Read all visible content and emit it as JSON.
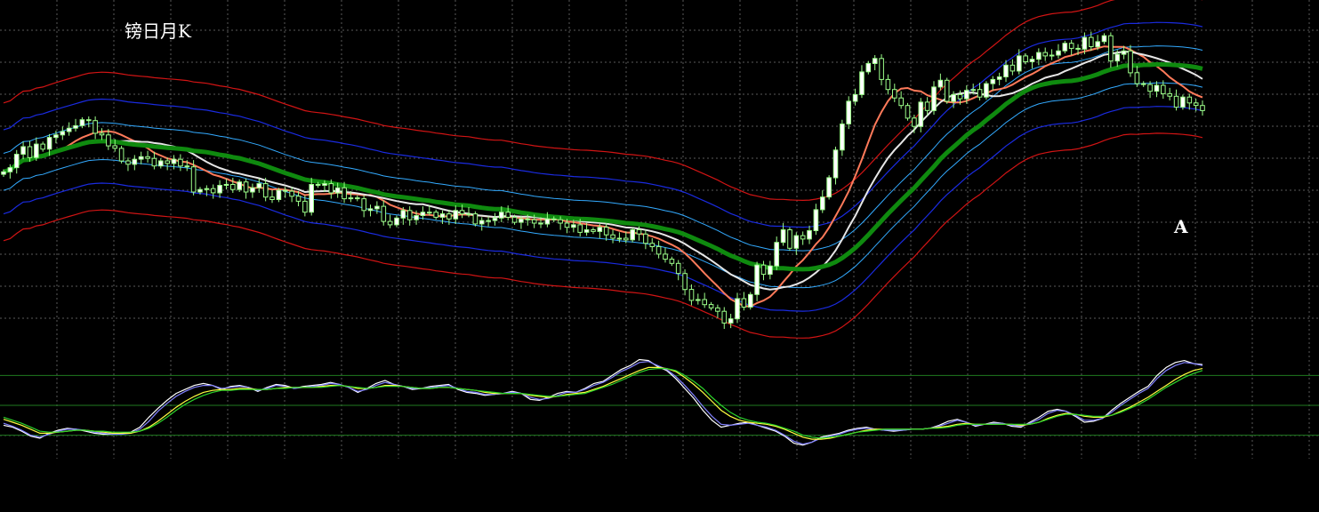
{
  "chart_data": {
    "type": "candlestick",
    "title": "镑日月K",
    "annotation": "A",
    "colors": {
      "background": "#000000",
      "grid": "#5a5a5a",
      "candle_up": "#ffffff",
      "candle_down": "#000000",
      "candle_outline": "#9dff8a",
      "ma_long": "#0f8a0f",
      "ma_mid": "#e6e6e6",
      "ma_fast": "#ff7a5a",
      "band_inner": "#33aaff",
      "band_mid": "#1a2be0",
      "band_outer": "#d11414",
      "osc_level": "#1f7a1f"
    },
    "price_closes": [
      206,
      211,
      227,
      236,
      223,
      239,
      233,
      247,
      250,
      254,
      258,
      261,
      268,
      267,
      252,
      250,
      237,
      234,
      219,
      215,
      221,
      224,
      222,
      213,
      219,
      216,
      221,
      213,
      212,
      182,
      185,
      186,
      181,
      190,
      191,
      185,
      194,
      182,
      187,
      192,
      176,
      173,
      184,
      183,
      177,
      171,
      158,
      191,
      190,
      192,
      181,
      187,
      174,
      175,
      174,
      160,
      162,
      165,
      147,
      143,
      151,
      160,
      149,
      154,
      158,
      158,
      152,
      156,
      150,
      160,
      156,
      156,
      144,
      148,
      148,
      151,
      158,
      152,
      146,
      150,
      149,
      145,
      144,
      150,
      149,
      145,
      140,
      143,
      134,
      137,
      135,
      140,
      131,
      127,
      127,
      125,
      137,
      132,
      121,
      117,
      108,
      102,
      97,
      85,
      66,
      53,
      54,
      48,
      44,
      40,
      26,
      31,
      55,
      45,
      60,
      95,
      84,
      94,
      122,
      137,
      115,
      130,
      126,
      136,
      161,
      176,
      199,
      232,
      263,
      290,
      298,
      325,
      335,
      341,
      316,
      304,
      294,
      285,
      270,
      260,
      289,
      279,
      307,
      315,
      290,
      298,
      293,
      303,
      304,
      295,
      311,
      316,
      319,
      333,
      326,
      344,
      337,
      340,
      348,
      344,
      345,
      350,
      359,
      353,
      352,
      366,
      355,
      361,
      368,
      338,
      346,
      350,
      324,
      311,
      310,
      302,
      309,
      299,
      296,
      283,
      295,
      288,
      285,
      279
    ],
    "oscillator": {
      "levels": [
        80,
        50,
        20
      ],
      "series": [
        {
          "color": "#ffffff",
          "values": [
            30,
            28,
            24,
            19,
            17,
            22,
            25,
            27,
            26,
            24,
            22,
            21,
            21,
            22,
            23,
            28,
            38,
            47,
            55,
            62,
            66,
            70,
            72,
            70,
            66,
            69,
            70,
            68,
            64,
            68,
            71,
            70,
            67,
            69,
            70,
            71,
            73,
            71,
            68,
            63,
            67,
            72,
            75,
            71,
            69,
            66,
            67,
            69,
            70,
            71,
            66,
            63,
            62,
            60,
            61,
            62,
            64,
            62,
            56,
            55,
            58,
            62,
            64,
            63,
            67,
            72,
            74,
            80,
            86,
            90,
            96,
            95,
            89,
            85,
            77,
            67,
            57,
            45,
            35,
            28,
            30,
            32,
            33,
            30,
            27,
            24,
            19,
            12,
            10,
            13,
            18,
            20,
            22,
            25,
            27,
            28,
            26,
            25,
            24,
            25,
            26,
            26,
            27,
            30,
            34,
            36,
            33,
            29,
            31,
            33,
            32,
            29,
            28,
            33,
            38,
            44,
            46,
            44,
            39,
            33,
            34,
            37,
            45,
            52,
            58,
            64,
            69,
            80,
            88,
            93,
            95,
            92,
            91
          ]
        },
        {
          "color": "#8080ff",
          "values": [
            32,
            29,
            25,
            20,
            18,
            21,
            24,
            26,
            26,
            25,
            23,
            22,
            21,
            21,
            22,
            26,
            34,
            44,
            52,
            59,
            64,
            68,
            70,
            70,
            67,
            68,
            69,
            68,
            65,
            67,
            70,
            69,
            67,
            68,
            69,
            70,
            72,
            71,
            68,
            64,
            66,
            70,
            73,
            71,
            69,
            67,
            67,
            68,
            69,
            70,
            67,
            64,
            63,
            61,
            61,
            62,
            63,
            62,
            58,
            56,
            57,
            60,
            63,
            63,
            66,
            70,
            73,
            78,
            84,
            88,
            93,
            94,
            90,
            86,
            79,
            70,
            60,
            49,
            39,
            31,
            30,
            31,
            32,
            30,
            28,
            25,
            20,
            14,
            11,
            13,
            17,
            19,
            21,
            24,
            26,
            27,
            26,
            25,
            25,
            25,
            26,
            26,
            27,
            29,
            32,
            35,
            33,
            30,
            31,
            32,
            32,
            30,
            29,
            32,
            36,
            42,
            45,
            44,
            40,
            35,
            35,
            37,
            43,
            50,
            56,
            62,
            67,
            77,
            85,
            90,
            93,
            92,
            90
          ]
        },
        {
          "color": "#ffff40",
          "values": [
            36,
            33,
            30,
            26,
            22,
            22,
            23,
            24,
            25,
            25,
            24,
            23,
            22,
            22,
            22,
            24,
            28,
            34,
            41,
            48,
            54,
            59,
            63,
            65,
            66,
            66,
            67,
            67,
            66,
            66,
            67,
            68,
            68,
            68,
            68,
            69,
            70,
            70,
            69,
            67,
            67,
            68,
            70,
            70,
            69,
            68,
            67,
            67,
            68,
            68,
            67,
            66,
            65,
            63,
            62,
            62,
            62,
            62,
            60,
            59,
            58,
            59,
            61,
            62,
            63,
            66,
            69,
            73,
            77,
            81,
            85,
            88,
            88,
            87,
            84,
            78,
            71,
            63,
            54,
            45,
            39,
            35,
            33,
            32,
            31,
            29,
            26,
            22,
            18,
            16,
            16,
            17,
            19,
            21,
            23,
            25,
            26,
            26,
            26,
            26,
            26,
            26,
            27,
            28,
            29,
            31,
            32,
            31,
            31,
            31,
            31,
            31,
            30,
            31,
            33,
            37,
            40,
            42,
            41,
            39,
            38,
            38,
            40,
            44,
            48,
            53,
            58,
            64,
            70,
            76,
            81,
            85,
            87
          ]
        },
        {
          "color": "#2bd32b",
          "values": [
            38,
            35,
            32,
            28,
            24,
            23,
            23,
            24,
            25,
            25,
            24,
            24,
            23,
            23,
            23,
            24,
            27,
            32,
            38,
            45,
            51,
            56,
            60,
            63,
            65,
            65,
            66,
            66,
            66,
            66,
            67,
            67,
            68,
            68,
            68,
            68,
            69,
            70,
            69,
            68,
            67,
            68,
            69,
            69,
            69,
            68,
            67,
            67,
            68,
            68,
            67,
            66,
            65,
            64,
            63,
            62,
            62,
            62,
            61,
            60,
            59,
            59,
            60,
            61,
            62,
            65,
            68,
            71,
            75,
            79,
            83,
            86,
            87,
            87,
            85,
            80,
            74,
            67,
            58,
            50,
            43,
            38,
            35,
            33,
            32,
            30,
            27,
            24,
            20,
            18,
            17,
            18,
            19,
            21,
            23,
            24,
            25,
            26,
            26,
            26,
            26,
            26,
            27,
            27,
            28,
            30,
            31,
            31,
            31,
            31,
            31,
            31,
            31,
            31,
            33,
            36,
            39,
            41,
            41,
            40,
            39,
            39,
            40,
            43,
            47,
            51,
            56,
            62,
            68,
            73,
            78,
            82,
            85
          ]
        }
      ]
    }
  }
}
